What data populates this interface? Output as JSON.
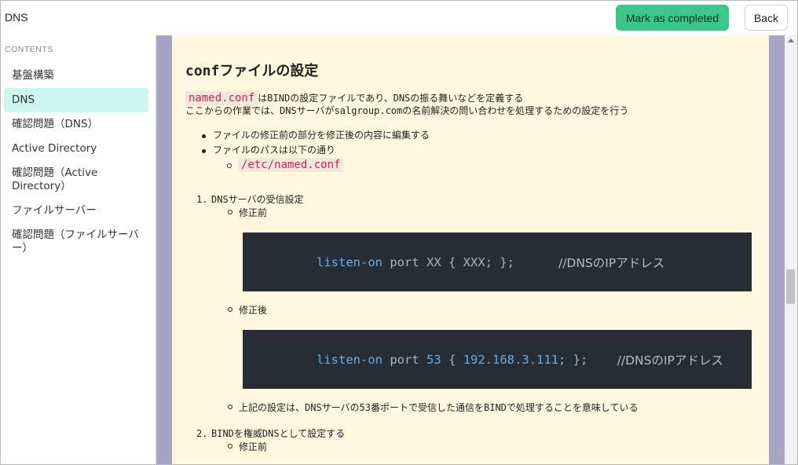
{
  "header": {
    "title": "DNS",
    "complete_label": "Mark as completed",
    "back_label": "Back",
    "accent": "#3cc78a"
  },
  "sidebar": {
    "heading": "CONTENTS",
    "items": [
      {
        "label": "基盤構築",
        "active": false
      },
      {
        "label": "DNS",
        "active": true
      },
      {
        "label": "確認問題（DNS）",
        "active": false
      },
      {
        "label": "Active Directory",
        "active": false
      },
      {
        "label": "確認問題（Active Directory）",
        "active": false
      },
      {
        "label": "ファイルサーバー",
        "active": false
      },
      {
        "label": "確認問題（ファイルサーバー）",
        "active": false
      }
    ]
  },
  "content": {
    "heading": "confファイルの設定",
    "intro_code": "named.conf",
    "intro_line1_rest": "はBINDの設定ファイルであり、DNSの振る舞いなどを定義する",
    "intro_line2": "ここからの作業では、DNSサーバがsalgroup.comの名前解決の問い合わせを処理するための設定を行う",
    "bullet1": "ファイルの修正前の部分を修正後の内容に編集する",
    "bullet2": "ファイルのパスは以下の通り",
    "path": "/etc/named.conf",
    "step1_number": "1.",
    "step1_title": "DNSサーバの受信設定",
    "before_label": "修正前",
    "after_label": "修正後",
    "code_before": {
      "kw": "listen-on",
      "rest": " port XX { XXX; };      ",
      "comment": "//DNSのIPアドレス"
    },
    "code_after": {
      "kw": "listen-on",
      "mid1": " port ",
      "num1": "53",
      "mid2": " { ",
      "num2": "192.168.3.111",
      "mid3": "; };    ",
      "comment": "//DNSのIPアドレス"
    },
    "note": "上記の設定は、DNSサーバの53番ポートで受信した通信をBINDで処理することを意味している",
    "step2_number": "2.",
    "step2_title": "BINDを権威DNSとして設定する",
    "step2_before_label": "修正前"
  }
}
